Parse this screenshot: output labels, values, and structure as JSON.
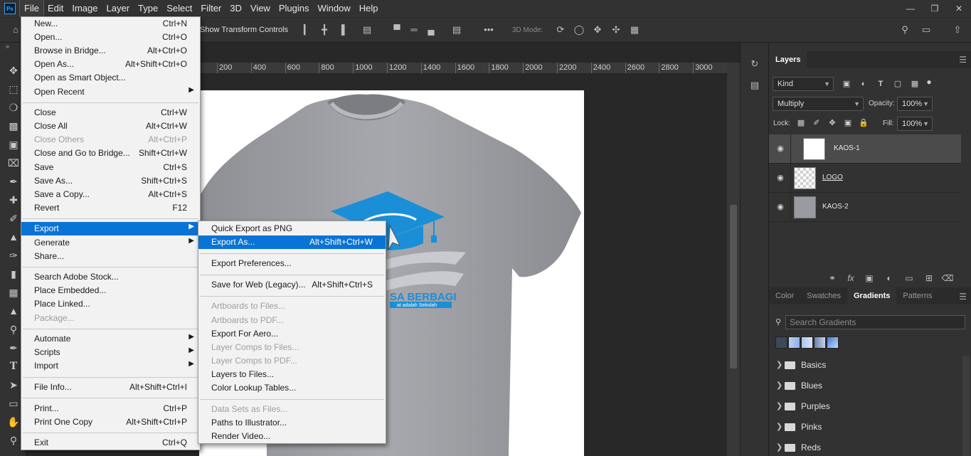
{
  "app": {
    "logo": "Ps",
    "menubar": [
      "File",
      "Edit",
      "Image",
      "Layer",
      "Type",
      "Select",
      "Filter",
      "3D",
      "View",
      "Plugins",
      "Window",
      "Help"
    ],
    "active_menu": "File"
  },
  "options_bar": {
    "show_transform_controls": "Show Transform Controls",
    "three_d_mode": "3D Mode:",
    "more": "•••"
  },
  "ruler": {
    "labels": [
      "200",
      "400",
      "600",
      "800",
      "1000",
      "1200",
      "1400",
      "1600",
      "1800",
      "2000",
      "2200",
      "2400",
      "2600",
      "2800",
      "3000"
    ]
  },
  "canvas": {
    "logo_text": "SA BERBAGI",
    "logo_subtext": "at adalah Sekolah",
    "shirt_color": "#9a9ba0",
    "logo_color": "#1a8fd8"
  },
  "file_menu": {
    "items": [
      {
        "label": "New...",
        "shortcut": "Ctrl+N"
      },
      {
        "label": "Open...",
        "shortcut": "Ctrl+O"
      },
      {
        "label": "Browse in Bridge...",
        "shortcut": "Alt+Ctrl+O"
      },
      {
        "label": "Open As...",
        "shortcut": "Alt+Shift+Ctrl+O"
      },
      {
        "label": "Open as Smart Object...",
        "shortcut": ""
      },
      {
        "label": "Open Recent",
        "shortcut": "",
        "submenu": true
      },
      {
        "sep": true
      },
      {
        "label": "Close",
        "shortcut": "Ctrl+W"
      },
      {
        "label": "Close All",
        "shortcut": "Alt+Ctrl+W"
      },
      {
        "label": "Close Others",
        "shortcut": "Alt+Ctrl+P",
        "disabled": true
      },
      {
        "label": "Close and Go to Bridge...",
        "shortcut": "Shift+Ctrl+W"
      },
      {
        "label": "Save",
        "shortcut": "Ctrl+S"
      },
      {
        "label": "Save As...",
        "shortcut": "Shift+Ctrl+S"
      },
      {
        "label": "Save a Copy...",
        "shortcut": "Alt+Ctrl+S"
      },
      {
        "label": "Revert",
        "shortcut": "F12"
      },
      {
        "sep": true
      },
      {
        "label": "Export",
        "shortcut": "",
        "submenu": true,
        "highlight": true
      },
      {
        "label": "Generate",
        "shortcut": "",
        "submenu": true
      },
      {
        "label": "Share...",
        "shortcut": ""
      },
      {
        "sep": true
      },
      {
        "label": "Search Adobe Stock...",
        "shortcut": ""
      },
      {
        "label": "Place Embedded...",
        "shortcut": ""
      },
      {
        "label": "Place Linked...",
        "shortcut": ""
      },
      {
        "label": "Package...",
        "shortcut": "",
        "disabled": true
      },
      {
        "sep": true
      },
      {
        "label": "Automate",
        "shortcut": "",
        "submenu": true
      },
      {
        "label": "Scripts",
        "shortcut": "",
        "submenu": true
      },
      {
        "label": "Import",
        "shortcut": "",
        "submenu": true
      },
      {
        "sep": true
      },
      {
        "label": "File Info...",
        "shortcut": "Alt+Shift+Ctrl+I"
      },
      {
        "sep": true
      },
      {
        "label": "Print...",
        "shortcut": "Ctrl+P"
      },
      {
        "label": "Print One Copy",
        "shortcut": "Alt+Shift+Ctrl+P"
      },
      {
        "sep": true
      },
      {
        "label": "Exit",
        "shortcut": "Ctrl+Q"
      }
    ]
  },
  "export_menu": {
    "items": [
      {
        "label": "Quick Export as PNG",
        "shortcut": ""
      },
      {
        "label": "Export As...",
        "shortcut": "Alt+Shift+Ctrl+W",
        "highlight": true
      },
      {
        "sep": true
      },
      {
        "label": "Export Preferences...",
        "shortcut": ""
      },
      {
        "sep": true
      },
      {
        "label": "Save for Web (Legacy)...",
        "shortcut": "Alt+Shift+Ctrl+S"
      },
      {
        "sep": true
      },
      {
        "label": "Artboards to Files...",
        "shortcut": "",
        "disabled": true
      },
      {
        "label": "Artboards to PDF...",
        "shortcut": "",
        "disabled": true
      },
      {
        "label": "Export For Aero...",
        "shortcut": ""
      },
      {
        "label": "Layer Comps to Files...",
        "shortcut": "",
        "disabled": true
      },
      {
        "label": "Layer Comps to PDF...",
        "shortcut": "",
        "disabled": true
      },
      {
        "label": "Layers to Files...",
        "shortcut": ""
      },
      {
        "label": "Color Lookup Tables...",
        "shortcut": ""
      },
      {
        "sep": true
      },
      {
        "label": "Data Sets as Files...",
        "shortcut": "",
        "disabled": true
      },
      {
        "label": "Paths to Illustrator...",
        "shortcut": ""
      },
      {
        "label": "Render Video...",
        "shortcut": ""
      }
    ]
  },
  "layers_panel": {
    "tab": "Layers",
    "kind_filter": "Kind",
    "blend_mode": "Multiply",
    "opacity_label": "Opacity:",
    "opacity_value": "100%",
    "lock_label": "Lock:",
    "fill_label": "Fill:",
    "fill_value": "100%",
    "layers": [
      {
        "name": "KAOS-1",
        "selected": true
      },
      {
        "name": "LOGO",
        "selected": false
      },
      {
        "name": "KAOS-2",
        "selected": false
      }
    ]
  },
  "gradients_panel": {
    "tabs": [
      "Color",
      "Swatches",
      "Gradients",
      "Patterns"
    ],
    "active_tab": "Gradients",
    "search_placeholder": "Search Gradients",
    "folders": [
      "Basics",
      "Blues",
      "Purples",
      "Pinks",
      "Reds"
    ]
  }
}
